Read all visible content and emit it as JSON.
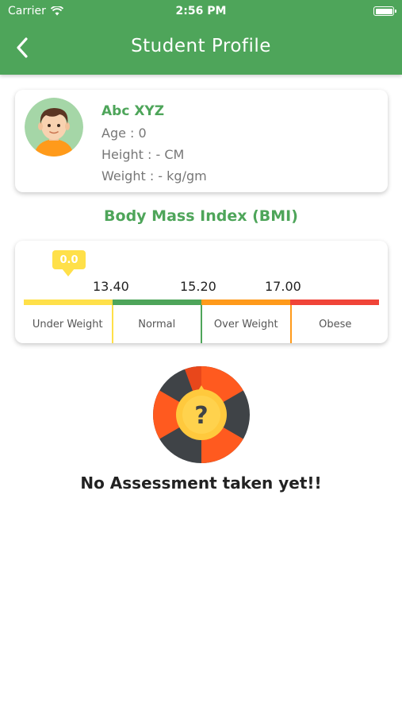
{
  "status_bar": {
    "carrier": "Carrier",
    "time": "2:56 PM"
  },
  "header": {
    "title": "Student Profile",
    "back_icon": "chevron-left-icon"
  },
  "profile": {
    "name": "Abc XYZ",
    "age": "Age : 0",
    "height": "Height : - CM",
    "weight": "Weight :  -  kg/gm",
    "avatar_icon": "student-avatar"
  },
  "bmi": {
    "title": "Body Mass Index (BMI)",
    "current_value": "0.0",
    "thresholds": [
      "13.40",
      "15.20",
      "17.00"
    ],
    "categories": [
      "Under Weight",
      "Normal",
      "Over Weight",
      "Obese"
    ],
    "category_colors": [
      "#ffe049",
      "#4ea55a",
      "#ff9a1a",
      "#f04438"
    ]
  },
  "assessment": {
    "message": "No Assessment taken yet!!",
    "icon": "question-wheel-icon"
  },
  "colors": {
    "primary": "#4ea55a",
    "warning": "#ffe049"
  }
}
